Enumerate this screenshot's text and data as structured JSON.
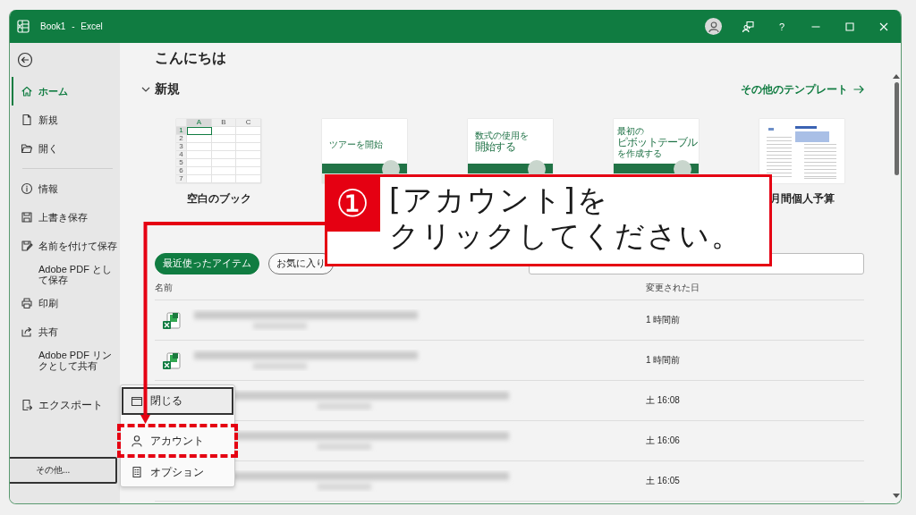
{
  "window": {
    "title": "Book1 - Excel",
    "help": "?"
  },
  "sidebar": {
    "groups": [
      {
        "divider": false,
        "items": [
          {
            "label": "ホーム",
            "selected": true
          },
          {
            "label": "新規",
            "selected": false
          },
          {
            "label": "開く",
            "selected": false
          }
        ]
      },
      {
        "divider": true,
        "items": [
          {
            "label": "情報",
            "selected": false
          },
          {
            "label": "上書き保存",
            "selected": false
          },
          {
            "label": "名前を付けて保存",
            "selected": false
          },
          {
            "label": "Adobe PDF として保存",
            "selected": false
          },
          {
            "label": "印刷",
            "selected": false
          },
          {
            "label": "共有",
            "selected": false
          },
          {
            "label": "Adobe PDF リンクとして共有",
            "selected": false
          }
        ]
      },
      {
        "divider": false,
        "items": [
          {
            "label": "エクスポート",
            "selected": false
          }
        ]
      }
    ],
    "more": {
      "label": "その他..."
    }
  },
  "main": {
    "greeting": "こんにちは",
    "new_section": {
      "title": "新規",
      "expanded": true,
      "more_link": "その他のテンプレート"
    },
    "templates": [
      {
        "kind": "blank",
        "label": "空白のブック",
        "columns": [
          "A",
          "B",
          "C"
        ],
        "rows": [
          "1",
          "2",
          "3",
          "4",
          "5",
          "6",
          "7"
        ]
      },
      {
        "kind": "tour",
        "caption": [
          {
            "text": "ツアーを開始",
            "emphasis": false
          }
        ]
      },
      {
        "kind": "formula",
        "caption": [
          {
            "text": "数式の使用を",
            "emphasis": false
          },
          {
            "text": "開始する",
            "emphasis": true
          }
        ]
      },
      {
        "kind": "pivot",
        "caption": [
          {
            "text": "最初の",
            "emphasis": false
          },
          {
            "text": "ピボットテーブル",
            "emphasis": true
          },
          {
            "text": "を作成する",
            "emphasis": false
          }
        ]
      },
      {
        "kind": "budget",
        "label": "月間個人予算"
      }
    ],
    "tabs": [
      {
        "label": "最近使ったアイテム",
        "selected": true
      },
      {
        "label": "お気に入り",
        "selected": false
      }
    ],
    "table": {
      "columns": [
        "名前",
        "変更された日"
      ],
      "rows": [
        {
          "modified": "1 時間前",
          "file_icon": true
        },
        {
          "modified": "1 時間前",
          "file_icon": true
        },
        {
          "modified": "土 16:08",
          "file_icon": false
        },
        {
          "modified": "土 16:06",
          "file_icon": false
        },
        {
          "modified": "土 16:05",
          "file_icon": false
        }
      ]
    }
  },
  "popup_menu": {
    "items": [
      {
        "label": "閉じる",
        "selected": true,
        "highlighted": false
      },
      {
        "label": "アカウント",
        "selected": false,
        "highlighted": true
      },
      {
        "label": "オプション",
        "selected": false,
        "highlighted": false
      }
    ]
  },
  "callout": {
    "number": "①",
    "lines": [
      "[アカウント]を",
      "クリックしてください。"
    ]
  }
}
